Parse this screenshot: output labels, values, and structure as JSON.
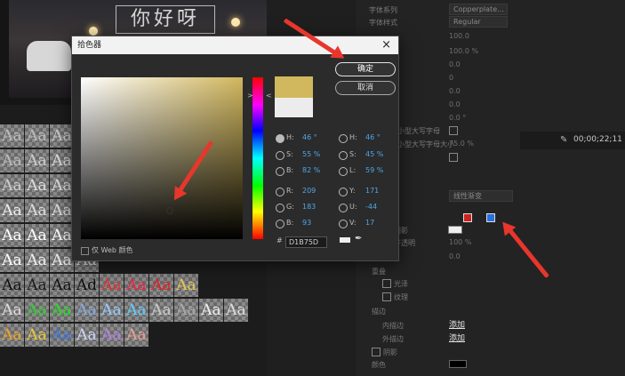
{
  "dialog": {
    "title": "拾色器",
    "close_glyph": "×",
    "ok_label": "确定",
    "cancel_label": "取消",
    "only_web_colors": "仅 Web 颜色",
    "hex_prefix": "#",
    "hex_value": "D1B75D",
    "new_color": "#d1b75d",
    "old_color": "#ececec",
    "fields_left": [
      {
        "label": "H:",
        "value": "46 °"
      },
      {
        "label": "S:",
        "value": "55 %"
      },
      {
        "label": "B:",
        "value": "82 %"
      },
      {
        "label": "R:",
        "value": "209"
      },
      {
        "label": "G:",
        "value": "183"
      },
      {
        "label": "B:",
        "value": "93"
      }
    ],
    "fields_right": [
      {
        "label": "H:",
        "value": "46 °"
      },
      {
        "label": "S:",
        "value": "45 %"
      },
      {
        "label": "L:",
        "value": "59 %"
      },
      {
        "label": "Y:",
        "value": "171"
      },
      {
        "label": "U:",
        "value": "-44"
      },
      {
        "label": "V:",
        "value": "17"
      }
    ]
  },
  "video": {
    "title_text": "你好呀"
  },
  "styles_grid": {
    "tile_text": "Aa",
    "extra_tile": "Ad"
  },
  "properties": {
    "rows": [
      {
        "label": "字体系列",
        "value": "Copperplate..."
      },
      {
        "label": "字体样式",
        "value": "Regular"
      },
      {
        "label": "",
        "value": "100.0"
      },
      {
        "label": "",
        "value": "100.0 %"
      },
      {
        "label": "",
        "value": "0.0"
      },
      {
        "label": "",
        "value": "0"
      },
      {
        "label": "",
        "value": "0.0"
      },
      {
        "label": "",
        "value": "0.0"
      },
      {
        "label": "",
        "value": "0.0"
      },
      {
        "label": "",
        "value": "0.0 °"
      }
    ],
    "small_caps": "小型大写字母",
    "small_caps_size_label": "小型大写字母大小",
    "small_caps_size_value": "75.0 %",
    "style_dropdown": "线性渐变",
    "opacity_value": "100 %",
    "zero_value": "0.0",
    "shadow_label": "阴影",
    "opacity_label": "不透明",
    "overlap_label": "重叠",
    "gloss_label": "光泽",
    "texture_label": "纹理",
    "stroke_label": "描边",
    "inner_stroke": "内描边",
    "outer_stroke": "外描边",
    "add_label": "添加",
    "shadow2_label": "阴影",
    "color_label": "颜色",
    "opacity2_label": "不透明度",
    "timecode": "00;00;22;11"
  }
}
